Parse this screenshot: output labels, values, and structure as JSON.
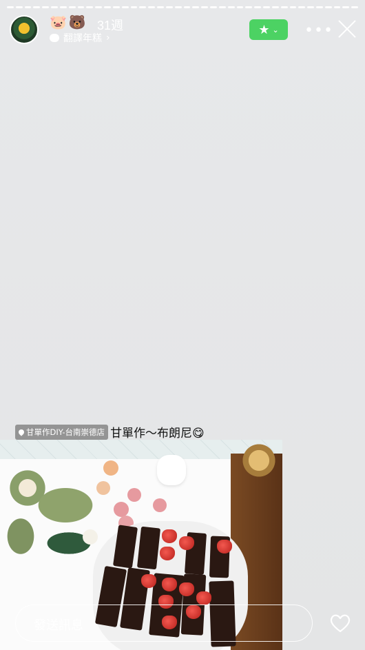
{
  "progress_segments": 40,
  "header": {
    "emojis": "🐷🐻",
    "age": "31週",
    "translate_label": "翻譯年糕",
    "chevron": "›",
    "favorite_icon": "star-icon",
    "more_icon": "•••",
    "close_icon": "close-icon"
  },
  "caption": {
    "location": "甘單作DIY-台南崇德店",
    "text": "甘單作～布朗尼😋"
  },
  "reply": {
    "placeholder": "發送訊息"
  },
  "colors": {
    "background": "#e6e7e8",
    "favorite_button": "#4cd263"
  }
}
